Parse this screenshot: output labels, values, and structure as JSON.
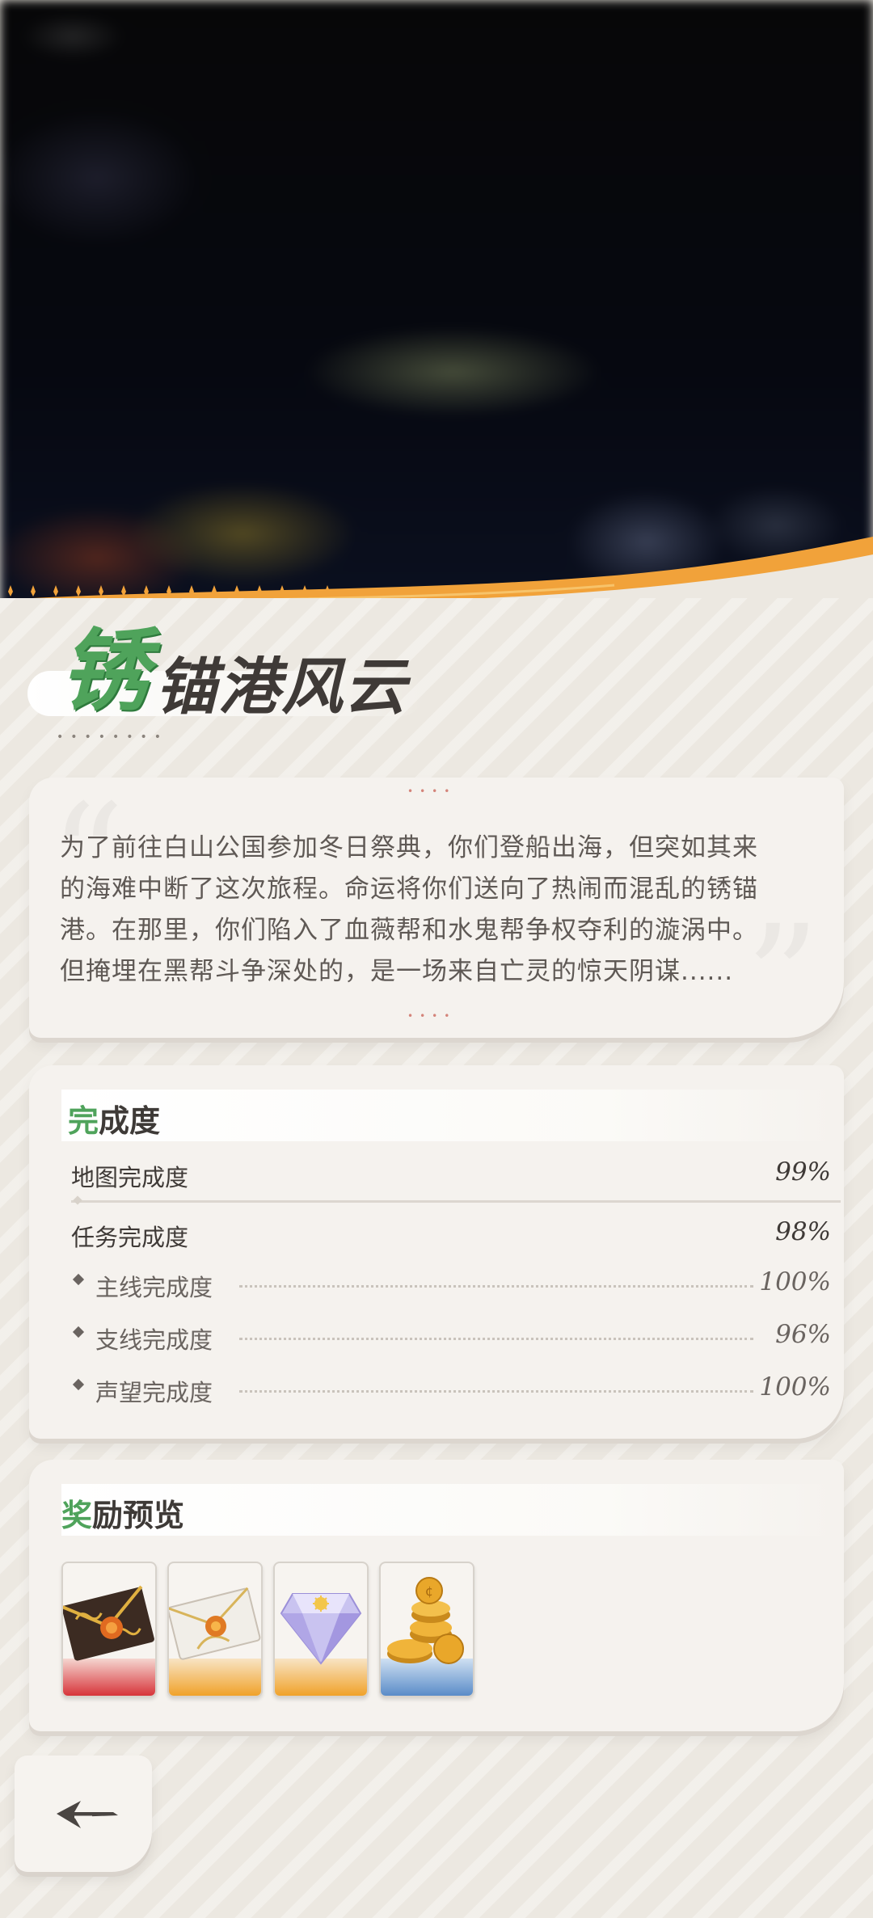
{
  "stage": {
    "title_first_char": "锈",
    "title_rest": "锚港风云"
  },
  "description": {
    "lines": [
      "为了前往白山公国参加冬日祭典，你们登船出海，但突如其来",
      "的海难中断了这次旅程。命运将你们送向了热闹而混乱的锈锚",
      "港。在那里，你们陷入了血薇帮和水鬼帮争权夺利的漩涡中。",
      "但掩埋在黑帮斗争深处的，是一场来自亡灵的惊天阴谋......"
    ]
  },
  "completion": {
    "title_hl": "完",
    "title_rest": "成度",
    "map": {
      "label": "地图完成度",
      "value": "99%"
    },
    "quest": {
      "label": "任务完成度",
      "value": "98%"
    },
    "sub_items": [
      {
        "label": "主线完成度",
        "value": "100%"
      },
      {
        "label": "支线完成度",
        "value": "96%"
      },
      {
        "label": "声望完成度",
        "value": "100%"
      }
    ]
  },
  "rewards": {
    "title_hl": "奖",
    "title_rest": "励预览",
    "items": [
      {
        "icon": "red-envelope-icon",
        "rarity_color": "#d7343a"
      },
      {
        "icon": "sealed-letter-icon",
        "rarity_color": "#f0a22a"
      },
      {
        "icon": "diamond-icon",
        "rarity_color": "#f0a22a"
      },
      {
        "icon": "gold-coins-icon",
        "rarity_color": "#5a8cc8"
      }
    ]
  },
  "colors": {
    "accent_green": "#4fa35b",
    "accent_orange": "#f0a22a",
    "text_dark": "#3f3a37"
  }
}
